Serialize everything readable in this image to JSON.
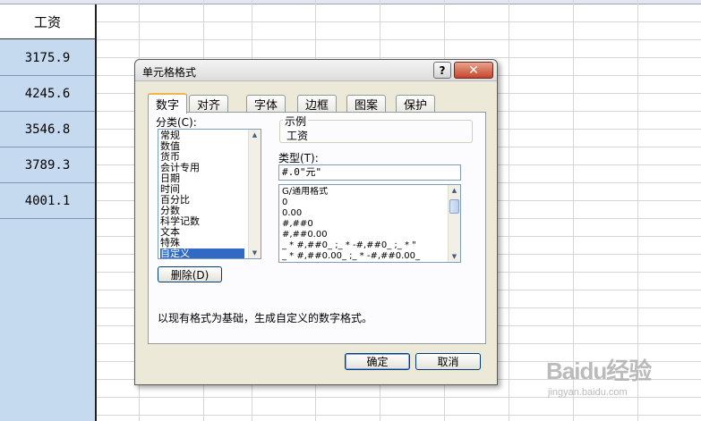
{
  "sheet": {
    "column_header": "工资",
    "values": [
      "3175.9",
      "4245.6",
      "3546.8",
      "3789.3",
      "4001.1"
    ]
  },
  "dialog": {
    "title": "单元格格式",
    "help_icon": "?",
    "close_icon": "✕",
    "tabs": [
      {
        "label": "数字",
        "active": true
      },
      {
        "label": "对齐",
        "active": false
      },
      {
        "label": "字体",
        "active": false
      },
      {
        "label": "边框",
        "active": false
      },
      {
        "label": "图案",
        "active": false
      },
      {
        "label": "保护",
        "active": false
      }
    ],
    "category_label": "分类(C):",
    "categories": [
      "常规",
      "数值",
      "货币",
      "会计专用",
      "日期",
      "时间",
      "百分比",
      "分数",
      "科学记数",
      "文本",
      "特殊",
      "自定义"
    ],
    "selected_category": "自定义",
    "sample_label": "示例",
    "sample_value": "工资",
    "type_label": "类型(T):",
    "type_value": "#.0\"元\"",
    "formats": [
      "G/通用格式",
      "0",
      "0.00",
      "#,##0",
      "#,##0.00",
      "_ * #,##0_ ;_ * -#,##0_ ;_ * \"",
      "_ * #,##0.00_ ;_ * -#,##0.00_"
    ],
    "delete_button": "删除(D)",
    "description": "以现有格式为基础，生成自定义的数字格式。",
    "ok_button": "确定",
    "cancel_button": "取消"
  },
  "watermark": {
    "main": "Baidu经验",
    "sub": "jingyan.baidu.com"
  }
}
